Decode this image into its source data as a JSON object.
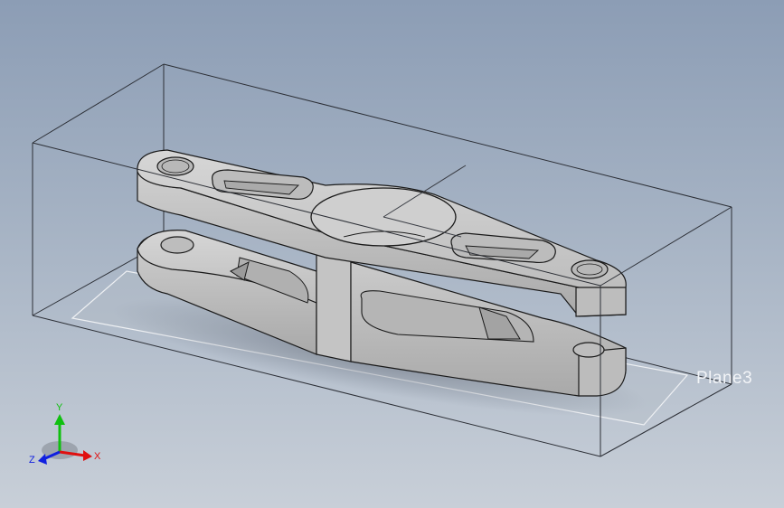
{
  "viewport": {
    "plane_label": "Plane3"
  },
  "triad": {
    "x_label": "X",
    "y_label": "Y",
    "z_label": "Z"
  },
  "colors": {
    "background_top": "#8c9db5",
    "background_bottom": "#c8cfd8",
    "part_face": "#c9c9c9",
    "part_edge": "#1a1a1a",
    "x_axis": "#e01010",
    "y_axis": "#10c010",
    "z_axis": "#1020e0"
  },
  "icons": {
    "triad": "coordinate-triad-icon"
  }
}
